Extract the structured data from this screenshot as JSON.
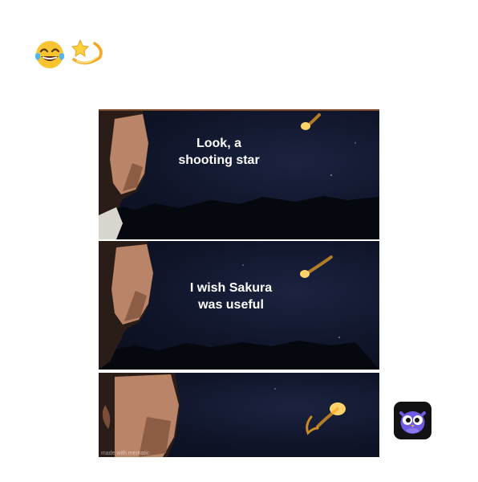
{
  "post": {
    "emojis": [
      "laughing-tears-emoji",
      "dizzy-star-emoji"
    ]
  },
  "meme": {
    "panels": [
      {
        "caption_line1": "Look, a",
        "caption_line2": "shooting star"
      },
      {
        "caption_line1": "I wish Sakura",
        "caption_line2": "was useful"
      },
      {
        "caption_line1": "",
        "caption_line2": ""
      }
    ],
    "watermark": "made with mematic"
  },
  "app": {
    "icon": "owl-app-icon"
  }
}
